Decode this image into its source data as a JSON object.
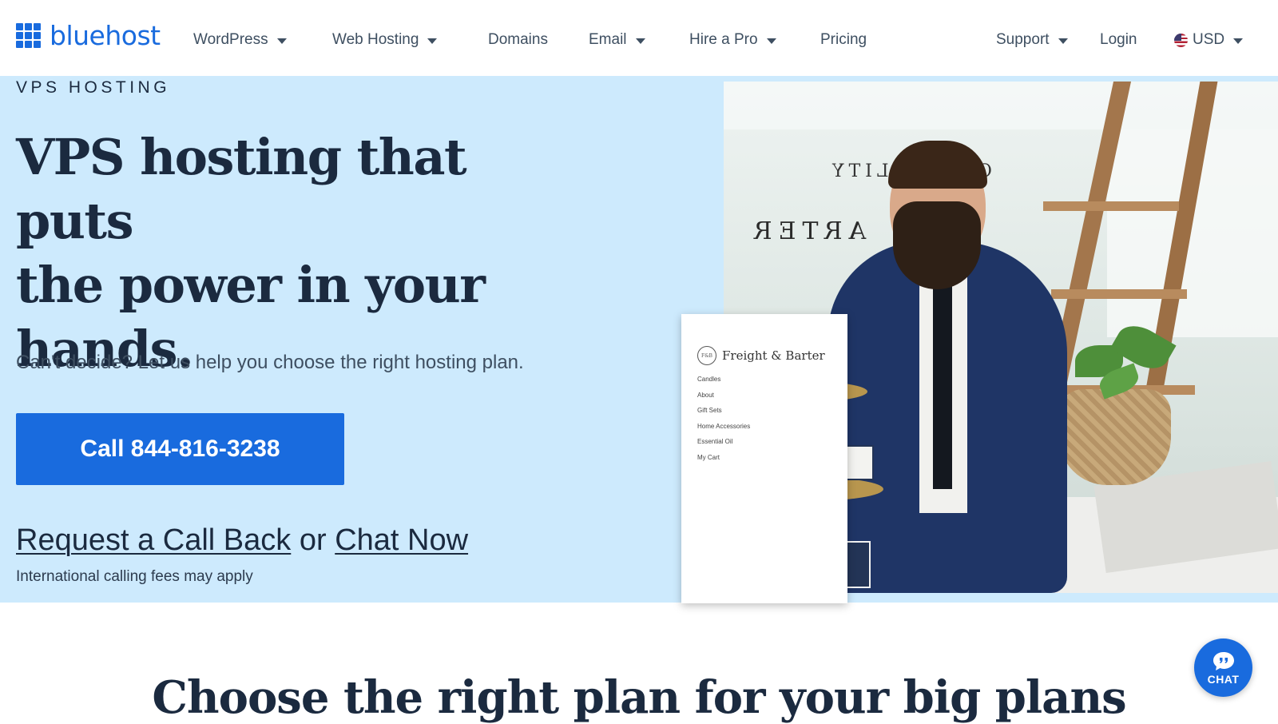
{
  "header": {
    "logo_text": "bluehost",
    "nav": [
      {
        "label": "WordPress",
        "dropdown": true
      },
      {
        "label": "Web Hosting",
        "dropdown": true
      },
      {
        "label": "Domains",
        "dropdown": false
      },
      {
        "label": "Email",
        "dropdown": true
      },
      {
        "label": "Hire a Pro",
        "dropdown": true
      },
      {
        "label": "Pricing",
        "dropdown": false
      }
    ],
    "support_label": "Support",
    "login_label": "Login",
    "currency_label": "USD"
  },
  "hero": {
    "eyebrow": "VPS HOSTING",
    "title_line1": "VPS hosting that puts",
    "title_line2": "the power in your",
    "title_line3": "hands.",
    "subtitle": "Can't decide? Let us help you choose the right hosting plan.",
    "call_button": "Call 844-816-3238",
    "request_callback": "Request a Call Back",
    "or_text": "or",
    "chat_now": "Chat Now",
    "fees_note": "International calling fees may apply"
  },
  "site_card": {
    "brand": "Freight & Barter",
    "brand_mark": "F&B",
    "menu": [
      "Candles",
      "About",
      "Gift Sets",
      "Home Accessories",
      "Essential Oil",
      "My Cart"
    ]
  },
  "photo_signs": {
    "top": "OR QUALITY",
    "middle": "ARTER"
  },
  "lower": {
    "title": "Choose the right plan for your big plans"
  },
  "chat_widget": {
    "label": "CHAT"
  },
  "colors": {
    "brand_blue": "#196bde",
    "hero_bg": "#cdeafd",
    "text_dark": "#1b2a3f"
  }
}
